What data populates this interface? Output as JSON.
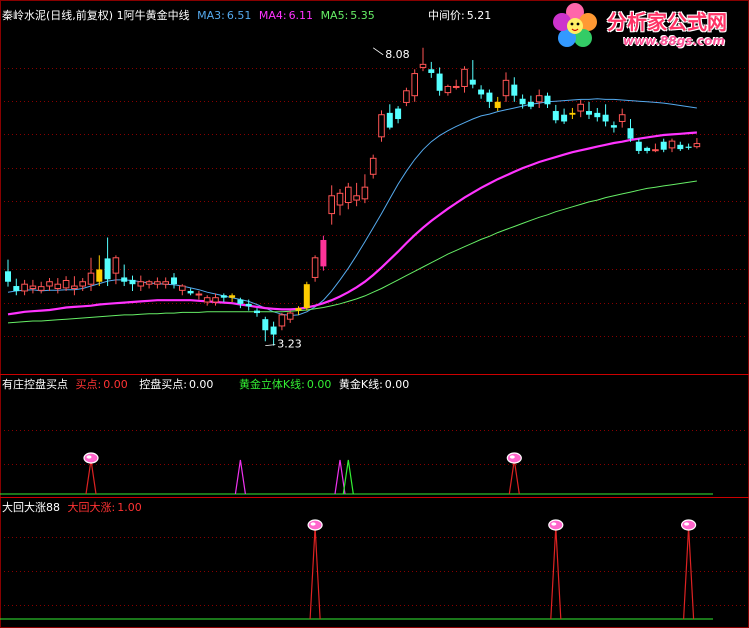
{
  "header": {
    "name": "秦岭水泥(日线,前复权)",
    "indicator": "1阿牛黄金中线",
    "ma3_label": "MA3:",
    "ma3_value": "6.51",
    "ma4_label": "MA4:",
    "ma4_value": "6.11",
    "ma5_label": "MA5:",
    "ma5_value": "5.35",
    "mid_label": "中间价:",
    "mid_value": "5.21"
  },
  "panel2": {
    "title": "有庄控盘买点",
    "buy_label": "买点:",
    "buy_value": "0.00",
    "ctrl_label": "控盘买点:",
    "ctrl_value": "0.00",
    "gold3d_label": "黄金立体K线:",
    "gold3d_value": "0.00",
    "goldk_label": "黄金K线:",
    "goldk_value": "0.00"
  },
  "panel3": {
    "title": "大回大涨88",
    "up_label": "大回大涨:",
    "up_value": "1.00"
  },
  "watermark": {
    "brand": "分析家公式网",
    "url": "www.88gs.com"
  },
  "colors": {
    "up": "#ff5555",
    "down": "#55ffff",
    "yellow": "#ffcc00",
    "magenta_candle": "#ff3399",
    "ma3": "#55aaee",
    "ma4": "#ff33ff",
    "ma5": "#66ee66",
    "grid": "#880000",
    "signal_red": "#dd2222",
    "signal_magenta": "#ee33ee",
    "signal_green": "#33ee33"
  },
  "chart_data": [
    {
      "type": "candlestick",
      "title": "秦岭水泥(日线,前复权) 1阿牛黄金中线",
      "ylim": [
        2.8,
        8.5
      ],
      "annotations": [
        {
          "label": "8.08",
          "value": 8.08,
          "index": 44
        },
        {
          "label": "3.23",
          "value": 3.23,
          "index": 31
        }
      ],
      "candles": [
        [
          4.27,
          4.44,
          4.19,
          4.63,
          "down"
        ],
        [
          4.12,
          4.2,
          4.05,
          4.32,
          "down"
        ],
        [
          4.12,
          4.23,
          4.05,
          4.3,
          "up"
        ],
        [
          4.16,
          4.2,
          4.08,
          4.3,
          "up"
        ],
        [
          4.13,
          4.19,
          4.08,
          4.27,
          "up"
        ],
        [
          4.2,
          4.27,
          4.12,
          4.33,
          "up"
        ],
        [
          4.16,
          4.23,
          4.08,
          4.33,
          "up"
        ],
        [
          4.17,
          4.29,
          4.12,
          4.36,
          "up"
        ],
        [
          4.16,
          4.2,
          4.05,
          4.36,
          "up"
        ],
        [
          4.2,
          4.27,
          4.12,
          4.33,
          "up"
        ],
        [
          4.23,
          4.41,
          4.12,
          4.66,
          "up"
        ],
        [
          4.27,
          4.47,
          4.2,
          4.7,
          "yellow"
        ],
        [
          4.65,
          4.31,
          4.2,
          4.99,
          "down"
        ],
        [
          4.66,
          4.41,
          4.23,
          4.7,
          "up"
        ],
        [
          4.34,
          4.27,
          4.2,
          4.55,
          "down"
        ],
        [
          4.23,
          4.3,
          4.12,
          4.37,
          "down"
        ],
        [
          4.2,
          4.27,
          4.12,
          4.37,
          "up"
        ],
        [
          4.23,
          4.27,
          4.16,
          4.3,
          "up"
        ],
        [
          4.23,
          4.27,
          4.16,
          4.34,
          "up"
        ],
        [
          4.23,
          4.27,
          4.16,
          4.34,
          "up"
        ],
        [
          4.23,
          4.34,
          4.16,
          4.41,
          "down"
        ],
        [
          4.13,
          4.2,
          4.05,
          4.23,
          "up"
        ],
        [
          4.12,
          4.08,
          4.05,
          4.16,
          "down"
        ],
        [
          4.07,
          4.07,
          3.98,
          4.12,
          "up"
        ],
        [
          3.94,
          4.01,
          3.88,
          4.05,
          "up"
        ],
        [
          3.94,
          4.01,
          3.88,
          4.08,
          "up"
        ],
        [
          4.01,
          4.05,
          3.94,
          4.08,
          "down"
        ],
        [
          4.05,
          4.01,
          3.94,
          4.08,
          "yellow"
        ],
        [
          3.91,
          3.98,
          3.84,
          4.01,
          "down"
        ],
        [
          3.91,
          3.87,
          3.8,
          3.98,
          "down"
        ],
        [
          3.8,
          3.76,
          3.7,
          3.84,
          "down"
        ],
        [
          3.66,
          3.48,
          3.3,
          3.7,
          "down"
        ],
        [
          3.54,
          3.41,
          3.23,
          3.62,
          "down"
        ],
        [
          3.55,
          3.73,
          3.48,
          3.76,
          "up"
        ],
        [
          3.66,
          3.76,
          3.6,
          3.8,
          "up"
        ],
        [
          3.8,
          3.84,
          3.73,
          3.87,
          "yellow"
        ],
        [
          3.84,
          4.23,
          3.8,
          4.27,
          "yellow"
        ],
        [
          4.34,
          4.66,
          4.27,
          4.7,
          "up"
        ],
        [
          4.52,
          4.95,
          4.45,
          5.02,
          "magenta"
        ],
        [
          5.38,
          5.67,
          5.2,
          5.84,
          "up"
        ],
        [
          5.52,
          5.71,
          5.35,
          5.78,
          "up"
        ],
        [
          5.56,
          5.81,
          5.45,
          5.88,
          "up"
        ],
        [
          5.6,
          5.67,
          5.5,
          5.88,
          "up"
        ],
        [
          5.62,
          5.81,
          5.55,
          6.02,
          "up"
        ],
        [
          6.02,
          6.28,
          5.95,
          6.34,
          "up"
        ],
        [
          6.63,
          6.99,
          6.55,
          7.06,
          "up"
        ],
        [
          7.02,
          6.78,
          6.75,
          7.16,
          "down"
        ],
        [
          7.09,
          6.92,
          6.85,
          7.13,
          "down"
        ],
        [
          7.19,
          7.38,
          7.13,
          7.43,
          "up"
        ],
        [
          7.3,
          7.66,
          7.2,
          7.73,
          "up"
        ],
        [
          7.76,
          7.81,
          7.7,
          8.08,
          "up"
        ],
        [
          7.73,
          7.67,
          7.59,
          7.85,
          "down"
        ],
        [
          7.66,
          7.38,
          7.3,
          7.76,
          "down"
        ],
        [
          7.45,
          7.35,
          7.3,
          7.48,
          "up"
        ],
        [
          7.45,
          7.45,
          7.4,
          7.56,
          "up"
        ],
        [
          7.45,
          7.73,
          7.35,
          7.78,
          "up"
        ],
        [
          7.56,
          7.48,
          7.42,
          7.88,
          "down"
        ],
        [
          7.4,
          7.32,
          7.25,
          7.47,
          "down"
        ],
        [
          7.35,
          7.2,
          7.1,
          7.4,
          "down"
        ],
        [
          7.2,
          7.1,
          7.05,
          7.28,
          "yellow"
        ],
        [
          7.3,
          7.55,
          7.2,
          7.68,
          "up"
        ],
        [
          7.48,
          7.3,
          7.2,
          7.6,
          "down"
        ],
        [
          7.25,
          7.16,
          7.09,
          7.32,
          "down"
        ],
        [
          7.2,
          7.12,
          7.08,
          7.3,
          "down"
        ],
        [
          7.2,
          7.3,
          7.1,
          7.4,
          "up"
        ],
        [
          7.3,
          7.16,
          7.1,
          7.35,
          "down"
        ],
        [
          7.05,
          6.9,
          6.85,
          7.15,
          "down"
        ],
        [
          6.99,
          6.88,
          6.84,
          7.09,
          "down"
        ],
        [
          6.99,
          7.02,
          6.92,
          7.1,
          "yellow"
        ],
        [
          7.05,
          7.16,
          6.95,
          7.23,
          "up"
        ],
        [
          7.05,
          6.99,
          6.92,
          7.2,
          "down"
        ],
        [
          7.02,
          6.95,
          6.88,
          7.1,
          "down"
        ],
        [
          6.99,
          6.88,
          6.8,
          7.16,
          "down"
        ],
        [
          6.82,
          6.78,
          6.7,
          6.88,
          "down"
        ],
        [
          6.88,
          6.99,
          6.78,
          7.09,
          "up"
        ],
        [
          6.77,
          6.6,
          6.55,
          6.92,
          "down"
        ],
        [
          6.55,
          6.4,
          6.35,
          6.6,
          "down"
        ],
        [
          6.45,
          6.4,
          6.36,
          6.47,
          "down"
        ],
        [
          6.42,
          6.42,
          6.38,
          6.52,
          "up"
        ],
        [
          6.55,
          6.42,
          6.38,
          6.6,
          "down"
        ],
        [
          6.45,
          6.56,
          6.38,
          6.6,
          "up"
        ],
        [
          6.5,
          6.43,
          6.4,
          6.55,
          "down"
        ],
        [
          6.45,
          6.47,
          6.42,
          6.52,
          "down"
        ],
        [
          6.47,
          6.52,
          6.44,
          6.61,
          "up"
        ]
      ],
      "series": [
        {
          "name": "MA3",
          "values": [
            4.1,
            4.12,
            4.13,
            4.14,
            4.12,
            4.13,
            4.13,
            4.14,
            4.14,
            4.16,
            4.2,
            4.24,
            4.28,
            4.3,
            4.3,
            4.29,
            4.27,
            4.25,
            4.24,
            4.23,
            4.22,
            4.2,
            4.17,
            4.14,
            4.1,
            4.07,
            4.04,
            4.01,
            3.98,
            3.95,
            3.9,
            3.84,
            3.78,
            3.74,
            3.72,
            3.73,
            3.78,
            3.86,
            3.97,
            4.12,
            4.3,
            4.49,
            4.7,
            4.92,
            5.15,
            5.38,
            5.62,
            5.86,
            6.07,
            6.26,
            6.42,
            6.55,
            6.65,
            6.73,
            6.8,
            6.86,
            6.92,
            6.97,
            7.0,
            7.04,
            7.07,
            7.1,
            7.13,
            7.16,
            7.18,
            7.2,
            7.21,
            7.22,
            7.23,
            7.24,
            7.24,
            7.25,
            7.24,
            7.24,
            7.23,
            7.22,
            7.21,
            7.2,
            7.19,
            7.18,
            7.16,
            7.14,
            7.12,
            7.1
          ]
        },
        {
          "name": "MA4",
          "values": [
            3.74,
            3.76,
            3.78,
            3.79,
            3.8,
            3.81,
            3.83,
            3.85,
            3.86,
            3.87,
            3.88,
            3.9,
            3.91,
            3.92,
            3.93,
            3.94,
            3.95,
            3.96,
            3.97,
            3.97,
            3.97,
            3.97,
            3.97,
            3.96,
            3.95,
            3.94,
            3.93,
            3.92,
            3.9,
            3.88,
            3.86,
            3.84,
            3.83,
            3.82,
            3.82,
            3.83,
            3.85,
            3.88,
            3.92,
            3.97,
            4.03,
            4.1,
            4.18,
            4.27,
            4.38,
            4.5,
            4.63,
            4.76,
            4.9,
            5.03,
            5.15,
            5.26,
            5.36,
            5.46,
            5.55,
            5.64,
            5.72,
            5.8,
            5.87,
            5.94,
            6.0,
            6.06,
            6.12,
            6.17,
            6.22,
            6.26,
            6.3,
            6.34,
            6.38,
            6.41,
            6.44,
            6.47,
            6.5,
            6.53,
            6.55,
            6.58,
            6.6,
            6.62,
            6.64,
            6.66,
            6.67,
            6.68,
            6.69,
            6.7
          ]
        },
        {
          "name": "MA5",
          "values": [
            3.6,
            3.61,
            3.62,
            3.63,
            3.63,
            3.64,
            3.65,
            3.66,
            3.67,
            3.68,
            3.69,
            3.7,
            3.71,
            3.72,
            3.73,
            3.73,
            3.74,
            3.75,
            3.75,
            3.76,
            3.76,
            3.77,
            3.77,
            3.77,
            3.78,
            3.78,
            3.78,
            3.78,
            3.78,
            3.78,
            3.78,
            3.78,
            3.78,
            3.78,
            3.79,
            3.8,
            3.81,
            3.83,
            3.85,
            3.88,
            3.91,
            3.95,
            3.99,
            4.04,
            4.1,
            4.16,
            4.23,
            4.3,
            4.37,
            4.44,
            4.51,
            4.58,
            4.65,
            4.72,
            4.78,
            4.84,
            4.9,
            4.96,
            5.01,
            5.07,
            5.12,
            5.17,
            5.22,
            5.27,
            5.32,
            5.36,
            5.41,
            5.45,
            5.49,
            5.53,
            5.57,
            5.6,
            5.64,
            5.67,
            5.7,
            5.73,
            5.76,
            5.79,
            5.81,
            5.83,
            5.85,
            5.87,
            5.89,
            5.91
          ]
        }
      ]
    },
    {
      "type": "line",
      "title": "有庄控盘买点",
      "ylim": [
        0,
        1
      ],
      "series": [
        {
          "name": "买点",
          "color": "red",
          "spikes": [
            {
              "index": 10,
              "value": 1,
              "marker": true
            },
            {
              "index": 61,
              "value": 1,
              "marker": true
            }
          ]
        },
        {
          "name": "控盘买点",
          "color": "magenta",
          "spikes": [
            {
              "index": 28,
              "value": 1
            },
            {
              "index": 40,
              "value": 1
            }
          ]
        },
        {
          "name": "黄金立体K线",
          "color": "green",
          "spikes": [
            {
              "index": 41,
              "value": 1
            }
          ]
        }
      ]
    },
    {
      "type": "line",
      "title": "大回大涨88",
      "ylim": [
        0,
        1
      ],
      "series": [
        {
          "name": "大回大涨",
          "color": "red",
          "spikes": [
            {
              "index": 37,
              "value": 1,
              "marker": true
            },
            {
              "index": 66,
              "value": 1,
              "marker": true
            },
            {
              "index": 82,
              "value": 1,
              "marker": true
            }
          ]
        }
      ]
    }
  ]
}
